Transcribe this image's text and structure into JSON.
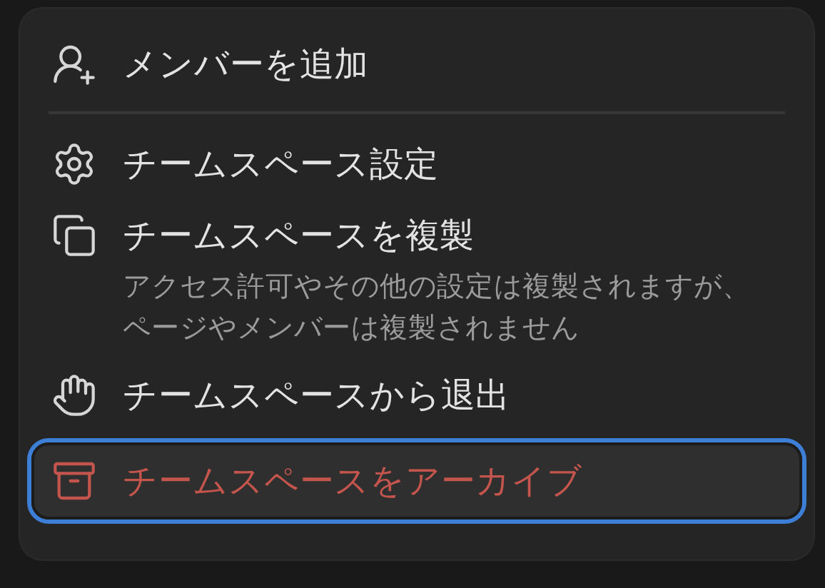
{
  "menu": {
    "items": [
      {
        "kind": "action",
        "label": "メンバーを追加",
        "selected": false,
        "divider_after": true
      },
      {
        "kind": "action",
        "label": "チームスペース設定",
        "selected": false
      },
      {
        "kind": "action",
        "label": "チームスペースを複製",
        "description": "アクセス許可やその他の設定は複製されますが、ページやメンバーは複製されません",
        "selected": false
      },
      {
        "kind": "action",
        "label": "チームスペースから退出",
        "selected": false
      },
      {
        "kind": "danger",
        "label": "チームスペースをアーカイブ",
        "selected": true
      }
    ]
  }
}
